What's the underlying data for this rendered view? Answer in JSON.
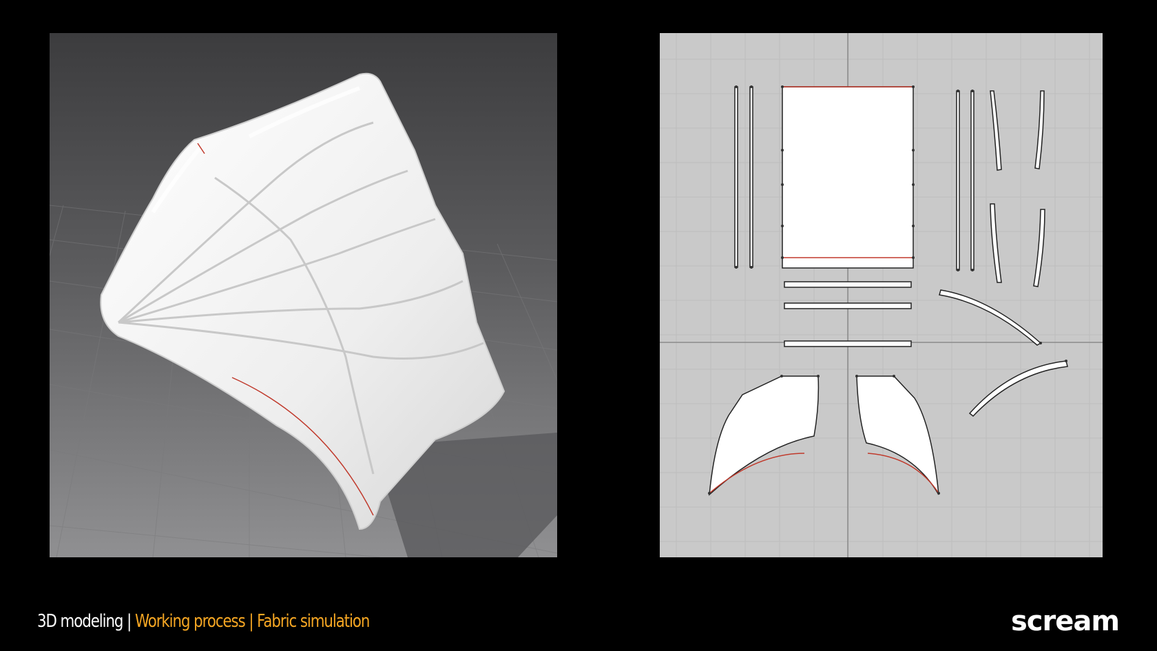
{
  "caption": {
    "part1": "3D modeling",
    "separator": "|",
    "part2": "Working process",
    "part3": "Fabric simulation",
    "color_primary": "#ffffff",
    "color_accent": "#f5a623"
  },
  "logo": {
    "text": "SCREAM",
    "display_text": "scream"
  },
  "colors": {
    "background": "#000000",
    "viewport_gradient_top": "#3d3d3f",
    "viewport_gradient_bottom": "#8a8a8c",
    "pattern_background": "#c9c9c9",
    "fabric": "#f2f2f2",
    "seam": "#c0392b"
  }
}
